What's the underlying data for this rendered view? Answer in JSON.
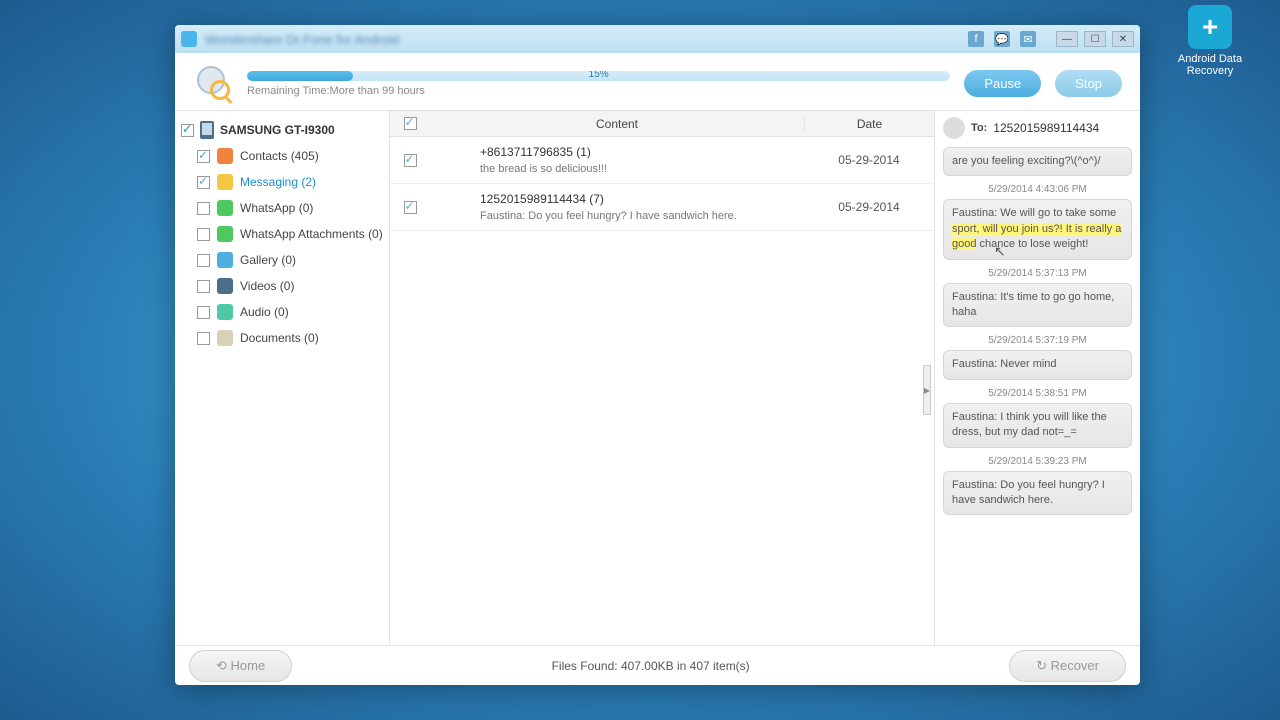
{
  "desktop": {
    "icon_label": "Android Data\nRecovery"
  },
  "titlebar": {
    "title": "Wondershare Dr.Fone for Android"
  },
  "progress": {
    "percent_text": "15%",
    "remaining": "Remaining Time:More than 99 hours",
    "pause": "Pause",
    "stop": "Stop"
  },
  "sidebar": {
    "device": "SAMSUNG GT-I9300",
    "items": [
      {
        "label": "Contacts (405)",
        "checked": true,
        "icn": "icn-contacts"
      },
      {
        "label": "Messaging (2)",
        "checked": true,
        "icn": "icn-msg",
        "active": true
      },
      {
        "label": "WhatsApp (0)",
        "checked": false,
        "icn": "icn-wa"
      },
      {
        "label": "WhatsApp Attachments (0)",
        "checked": false,
        "icn": "icn-waatt"
      },
      {
        "label": "Gallery (0)",
        "checked": false,
        "icn": "icn-gallery"
      },
      {
        "label": "Videos (0)",
        "checked": false,
        "icn": "icn-video"
      },
      {
        "label": "Audio (0)",
        "checked": false,
        "icn": "icn-audio"
      },
      {
        "label": "Documents (0)",
        "checked": false,
        "icn": "icn-docs"
      }
    ]
  },
  "table": {
    "head_content": "Content",
    "head_date": "Date",
    "rows": [
      {
        "title": "+8613711796835 (1)",
        "preview": "the bread is so delicious!!!",
        "date": "05-29-2014"
      },
      {
        "title": "1252015989114434 (7)",
        "preview": "Faustina: Do you feel hungry? I have sandwich here.",
        "date": "05-29-2014"
      }
    ]
  },
  "preview": {
    "to_label": "To:",
    "to_number": "1252015989114434",
    "first_bubble": "are you feeling exciting?\\(^o^)/",
    "messages": [
      {
        "time": "5/29/2014 4:43:06 PM",
        "text_pre": "Faustina: We will go to take some ",
        "text_hl": "sport, will you join us?! It is really a good",
        "text_post": " chance to lose weight!",
        "highlight": true
      },
      {
        "time": "5/29/2014 5:37:13 PM",
        "text": "Faustina: It's time to go go home, haha"
      },
      {
        "time": "5/29/2014 5:37:19 PM",
        "text": "Faustina: Never mind"
      },
      {
        "time": "5/29/2014 5:38:51 PM",
        "text": "Faustina: I think you will like the dress, but my dad not=_="
      },
      {
        "time": "5/29/2014 5:39:23 PM",
        "text": "Faustina: Do you feel hungry? I have sandwich here."
      }
    ]
  },
  "footer": {
    "home": "Home",
    "status": "Files Found: 407.00KB in 407 item(s)",
    "recover": "Recover"
  }
}
